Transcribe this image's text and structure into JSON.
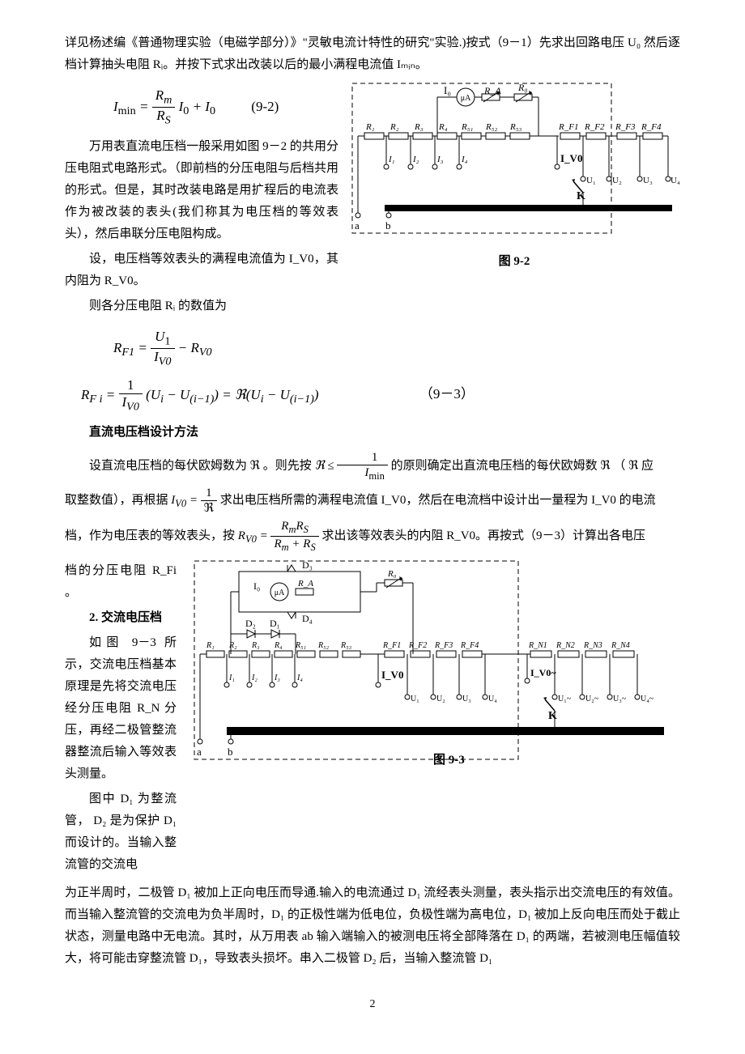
{
  "p1": "详见杨述编《普通物理实验（电磁学部分）》\"灵敏电流计特性的研究\"实验.)按式（9－1）先求出回路电压 U₀ 然后逐档计算抽头电阻 Rᵢ。并按下式求出改装以后的最小满程电流值 Iₘᵢₙ。",
  "eq92": "(9-2)",
  "p2": "万用表直流电压档一般采用如图 9－2 的共用分压电阻式电路形式。（即前档的分压电阻与后档共用的形式。但是，其时改装电路是用扩程后的电流表作为被改装的表头(我们称其为电压档的等效表头），然后串联分压电阻构成。",
  "p3": "设，电压档等效表头的满程电流值为 I_V0，其内阻为 R_V0。",
  "p4": "则各分压电阻 Rᵢ 的数值为",
  "eq93": "（9－3）",
  "h1": "直流电压档设计方法",
  "p5a": "设直流电压档的每伏欧姆数为 ℜ 。则先按",
  "p5b": "的原则确定出直流电压档的每伏欧姆数 ℜ （ ℜ 应",
  "p6a": "取整数值），再根据",
  "p6b": "求出电压档所需的满程电流值 I_V0，然后在电流档中设计出一量程为 I_V0 的电流",
  "p7a": "档，作为电压表的等效表头，按",
  "p7b": "求出该等效表头的内阻 R_V0。再按式（9－3）计算出各电压",
  "p8": "档的分压电阻 R_Fi 。",
  "h2": "2. 交流电压档",
  "p9": "如图 9－3 所示，交流电压档基本原理是先将交流电压经分压电阻 R_N 分压，再经二极管整流器整流后输入等效表头测量。",
  "p10": "图中 D₁ 为整流管， D₂ 是为保护 D₁ 而设计的。当输入整流管的交流电",
  "p11": "为正半周时，二极管 D₁ 被加上正向电压而导通.输入的电流通过 D₁ 流经表头测量，表头指示出交流电压的有效值。而当输入整流管的交流电为负半周时，D₁ 的正极性端为低电位，负极性端为高电位，D₁ 被加上反向电压而处于截止状态，测量电路中无电流。其时，从万用表 ab 输入端输入的被测电压将全部降落在 D₁ 的两端，若被测电压幅值较大，将可能击穿整流管 D₁，导致表头损坏。串入二极管 D₂ 后，当输入整流管 D₁",
  "fig92": "图 9-2",
  "fig93": "图 9-3",
  "pgnum": "2",
  "circuit92": {
    "meter": "μA",
    "I0": "I₀",
    "RA": "R_A",
    "R0": "R₀",
    "resistors_top": [
      "R₁",
      "R₂",
      "R₃",
      "R₄",
      "R₅₁",
      "R₅₂",
      "R₅₃"
    ],
    "RF": [
      "R_F1",
      "R_F2",
      "R_F3",
      "R_F4"
    ],
    "taps_I": [
      "I₁",
      "I₂",
      "I₃",
      "I₄"
    ],
    "IV0": "I_V0",
    "taps_U": [
      "U₁",
      "U₂",
      "U₃",
      "U₄"
    ],
    "K": "K",
    "a": "a",
    "b": "b"
  },
  "circuit93": {
    "meter": "μA",
    "I0": "I₀",
    "RA": "R_A",
    "R0": "R₀",
    "D": [
      "D₁",
      "D₂",
      "D₃",
      "D₄"
    ],
    "resistors_top": [
      "R₁",
      "R₂",
      "R₃",
      "R₄",
      "R₅₁",
      "R₅₂",
      "R₅₃"
    ],
    "RF": [
      "R_F1",
      "R_F2",
      "R_F3",
      "R_F4"
    ],
    "RN": [
      "R_N1",
      "R_N2",
      "R_N3",
      "R_N4"
    ],
    "taps_I": [
      "I₁",
      "I₂",
      "I₃",
      "I₄"
    ],
    "IV0": "I_V0",
    "IV0ac": "I_V0~",
    "taps_U": [
      "U₁",
      "U₂",
      "U₃",
      "U₄"
    ],
    "taps_Uac": [
      "U₁~",
      "U₂~",
      "U₃~",
      "U₄~"
    ],
    "K": "K",
    "a": "a",
    "b": "b"
  }
}
